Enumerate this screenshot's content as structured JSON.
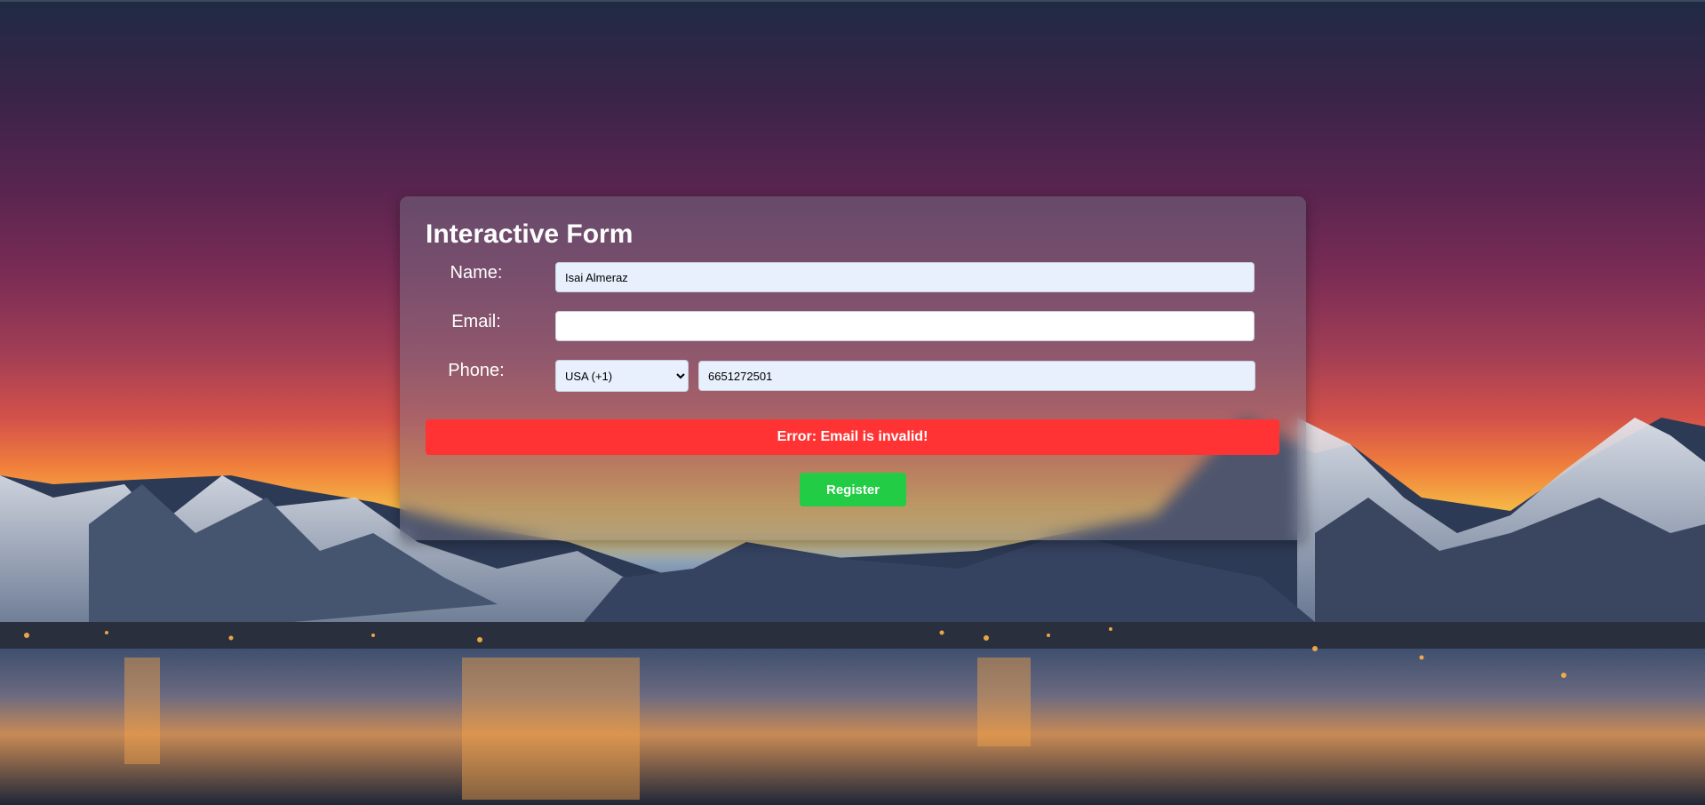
{
  "form": {
    "title": "Interactive Form",
    "name_label": "Name:",
    "name_value": "Isai Almeraz",
    "email_label": "Email:",
    "email_value": "",
    "phone_label": "Phone:",
    "country_selected": "USA (+1)",
    "phone_value": "6651272501",
    "error_message": "Error: Email is invalid!",
    "register_label": "Register"
  },
  "colors": {
    "error": "#ff3333",
    "register_button": "#22cc44",
    "autofill_input": "#e8f0fe"
  }
}
